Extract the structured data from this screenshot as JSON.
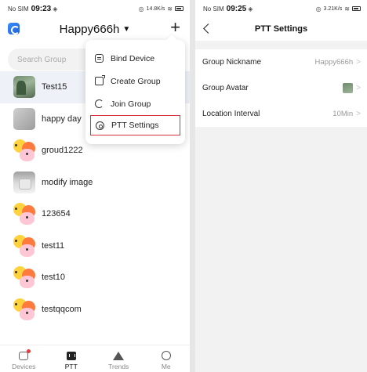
{
  "left": {
    "status": {
      "carrier": "No SIM",
      "time": "09:23",
      "speed": "14.8K/s"
    },
    "header": {
      "title": "Happy666h"
    },
    "search": {
      "placeholder": "Search Group"
    },
    "groups": [
      {
        "name": "Test15",
        "avatar": "photo1"
      },
      {
        "name": "happy day",
        "avatar": "photo2"
      },
      {
        "name": "groud1222",
        "avatar": "emoji"
      },
      {
        "name": "modify image",
        "avatar": "photo3"
      },
      {
        "name": "123654",
        "avatar": "emoji"
      },
      {
        "name": "test11",
        "avatar": "emoji"
      },
      {
        "name": "test10",
        "avatar": "emoji"
      },
      {
        "name": "testqqcom",
        "avatar": "emoji"
      }
    ],
    "menu": {
      "items": [
        {
          "label": "Bind Device",
          "icon": "bind-device-icon"
        },
        {
          "label": "Create Group",
          "icon": "create-group-icon"
        },
        {
          "label": "Join Group",
          "icon": "join-group-icon"
        },
        {
          "label": "PTT Settings",
          "icon": "ptt-settings-icon"
        }
      ]
    },
    "nav": [
      {
        "label": "Devices"
      },
      {
        "label": "PTT"
      },
      {
        "label": "Trends"
      },
      {
        "label": "Me"
      }
    ]
  },
  "right": {
    "status": {
      "carrier": "No SIM",
      "time": "09:25",
      "speed": "3.21K/s"
    },
    "header": {
      "title": "PTT Settings"
    },
    "settings": [
      {
        "label": "Group Nickname",
        "value": "Happy666h"
      },
      {
        "label": "Group Avatar",
        "value": ""
      },
      {
        "label": "Location Interval",
        "value": "10Min"
      }
    ]
  },
  "colors": {
    "highlight": "#d9303b",
    "selected_row": "#eef1f8",
    "accent": "#1e5fd8"
  }
}
